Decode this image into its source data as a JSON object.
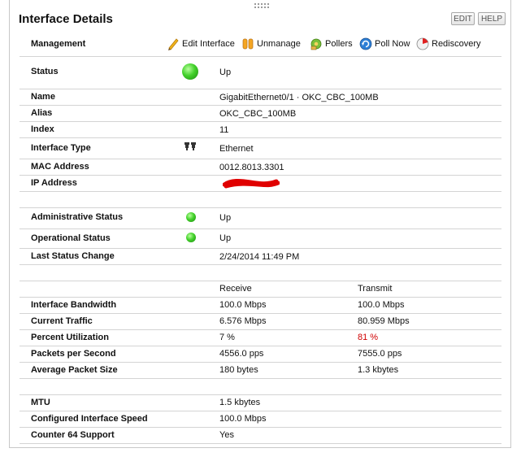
{
  "header": {
    "title": "Interface Details",
    "edit": "EDIT",
    "help": "HELP"
  },
  "management": {
    "label": "Management",
    "actions": {
      "edit_interface": "Edit Interface",
      "unmanage": "Unmanage",
      "pollers": "Pollers",
      "poll_now": "Poll Now",
      "rediscovery": "Rediscovery"
    }
  },
  "status": {
    "label": "Status",
    "value": "Up",
    "icon": "green-status-icon"
  },
  "details": {
    "name": {
      "label": "Name",
      "value": "GigabitEthernet0/1 · OKC_CBC_100MB"
    },
    "alias": {
      "label": "Alias",
      "value": "OKC_CBC_100MB"
    },
    "index": {
      "label": "Index",
      "value": "11"
    },
    "interface_type": {
      "label": "Interface Type",
      "value": "Ethernet",
      "icon": "ethernet-port-icon"
    },
    "mac_address": {
      "label": "MAC Address",
      "value": "0012.8013.3301"
    },
    "ip_address": {
      "label": "IP Address"
    }
  },
  "state": {
    "admin_status": {
      "label": "Administrative Status",
      "value": "Up"
    },
    "oper_status": {
      "label": "Operational Status",
      "value": "Up"
    },
    "last_change": {
      "label": "Last Status Change",
      "value": "2/24/2014 11:49 PM"
    }
  },
  "traffic": {
    "headers": {
      "receive": "Receive",
      "transmit": "Transmit"
    },
    "bandwidth": {
      "label": "Interface Bandwidth",
      "receive": "100.0 Mbps",
      "transmit": "100.0 Mbps"
    },
    "current_traffic": {
      "label": "Current Traffic",
      "receive": "6.576 Mbps",
      "transmit": "80.959 Mbps"
    },
    "percent_util": {
      "label": "Percent Utilization",
      "receive": "7 %",
      "transmit": "81 %"
    },
    "pps": {
      "label": "Packets per Second",
      "receive": "4556.0 pps",
      "transmit": "7555.0 pps"
    },
    "avg_packet": {
      "label": "Average Packet Size",
      "receive": "180 bytes",
      "transmit": "1.3 kbytes"
    }
  },
  "config": {
    "mtu": {
      "label": "MTU",
      "value": "1.5 kbytes"
    },
    "speed": {
      "label": "Configured Interface Speed",
      "value": "100.0 Mbps"
    },
    "counter64": {
      "label": "Counter 64 Support",
      "value": "Yes"
    }
  },
  "colors": {
    "accent_red": "#d00000",
    "status_green": "#43d12b",
    "redaction": "#e00000"
  }
}
